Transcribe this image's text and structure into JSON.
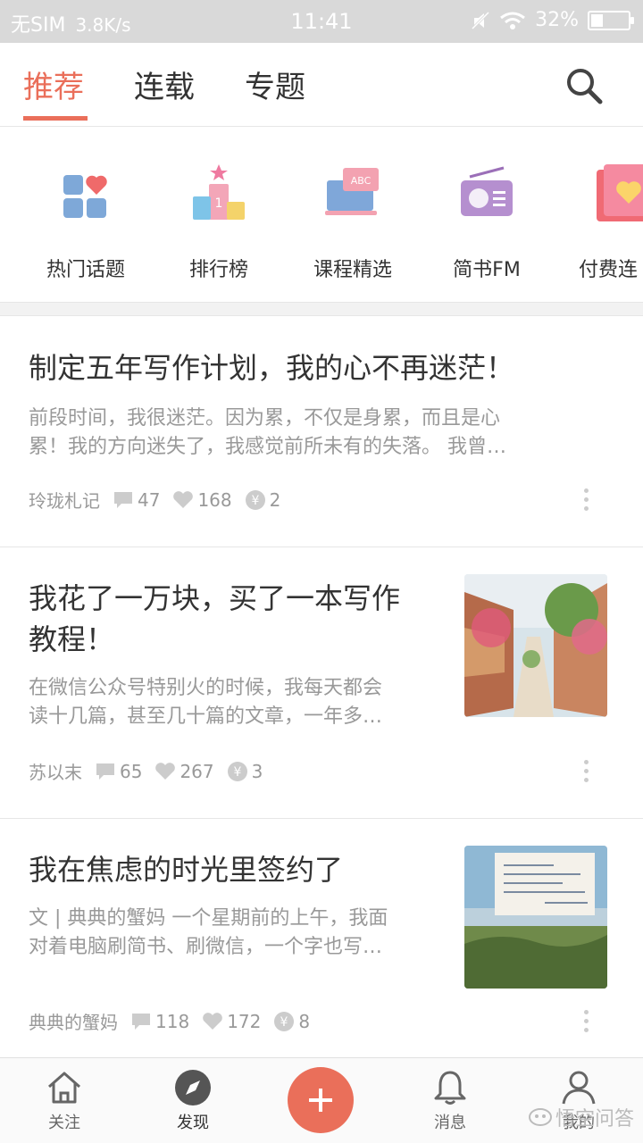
{
  "status_bar": {
    "carrier": "无SIM",
    "speed": "3.8K/s",
    "time": "11:41",
    "battery": "32%",
    "battery_level": 0.32
  },
  "top_tabs": [
    "推荐",
    "连载",
    "专题"
  ],
  "active_tab": "推荐",
  "categories": [
    {
      "label": "热门话题",
      "icon": "grid-heart-icon"
    },
    {
      "label": "排行榜",
      "icon": "podium-icon"
    },
    {
      "label": "课程精选",
      "icon": "abc-board-icon"
    },
    {
      "label": "简书FM",
      "icon": "radio-icon"
    },
    {
      "label": "付费连",
      "icon": "heart-card-icon"
    }
  ],
  "articles": [
    {
      "title": "制定五年写作计划，我的心不再迷茫！",
      "abstract_1": "前段时间，我很迷茫。因为累，不仅是身累，而且是心",
      "abstract_2": "累！我的方向迷失了，我感觉前所未有的失落。 我曾…",
      "author": "玲珑札记",
      "comments": "47",
      "likes": "168",
      "rewards": "2"
    },
    {
      "title_1": "我花了一万块，买了一本写作",
      "title_2": "教程！",
      "abstract_1": "在微信公众号特别火的时候，我每天都会",
      "abstract_2": "读十几篇，甚至几十篇的文章，一年多…",
      "author": "苏以末",
      "comments": "65",
      "likes": "267",
      "rewards": "3"
    },
    {
      "title": "我在焦虑的时光里签约了",
      "abstract_1": "文 | 典典的蟹妈 一个星期前的上午，我面",
      "abstract_2": "对着电脑刷简书、刷微信，一个字也写…",
      "author": "典典的蟹妈",
      "comments": "118",
      "likes": "172",
      "rewards": "8"
    }
  ],
  "bottom_nav": {
    "follow": "关注",
    "discover": "发现",
    "messages": "消息",
    "mine": "我的",
    "watermark": "悟空问答"
  },
  "colors": {
    "accent": "#ea6f5a",
    "muted": "#999999",
    "statusbar": "#d9d9d9"
  }
}
